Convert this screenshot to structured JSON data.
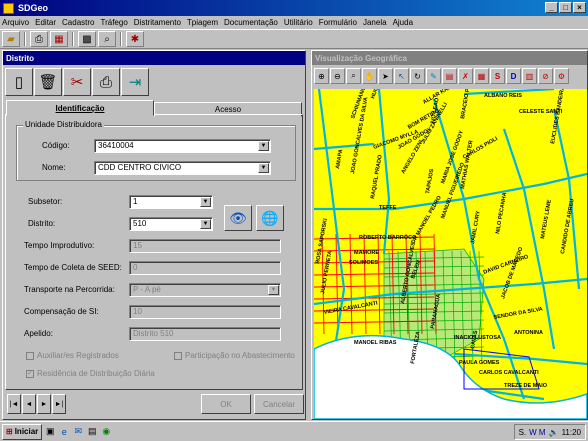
{
  "window": {
    "title": "SDGeo",
    "controls": [
      "_",
      "□",
      "×"
    ]
  },
  "menu": [
    "Arquivo",
    "Editar",
    "Cadastro",
    "Tráfego",
    "Distritamento",
    "Tpiagem",
    "Documentação",
    "Utilitário",
    "Formulário",
    "Janela",
    "Ajuda"
  ],
  "toolbar": {
    "icons": [
      "folder-icon",
      "printer-icon",
      "layout-icon",
      "grid-icon",
      "zoom-icon",
      "cross-icon"
    ]
  },
  "distrito": {
    "panel_title": "Distrito",
    "tabs": [
      "Identificação",
      "Acesso"
    ],
    "group_label": "Unidade Distribuidora",
    "codigo_label": "Código:",
    "codigo_value": "36410004",
    "nome_label": "Nome:",
    "nome_value": "CDD CENTRO CIVICO",
    "subsetor_label": "Subsetor:",
    "subsetor_value": "1",
    "distrito_label": "Distrito:",
    "distrito_value": "510",
    "tempo_improdutivo_label": "Tempo Improdutivo:",
    "tempo_improdutivo_value": "15",
    "tempo_coleta_label": "Tempo de Coleta de SEED:",
    "tempo_coleta_value": "0",
    "transporte_label": "Transporte na Percorrida:",
    "transporte_value": "P - A pé",
    "compensacao_label": "Compensação de SI:",
    "compensacao_value": "10",
    "apelido_label": "Apelido:",
    "apelido_value": "Distrito 510",
    "chk_auxiliar": "Auxiliar/es Registrados",
    "chk_participacao": "Participação no Abastecimento",
    "chk_residencia": "Residência de Distribuição Diária",
    "ok_label": "OK",
    "cancel_label": "Cancelar",
    "nav": [
      "|◄",
      "◄",
      "►",
      "►|"
    ]
  },
  "map": {
    "title": "Visualização Geográfica",
    "streets": [
      "ALBANO REIS",
      "CELESTE SANTI",
      "SCHIUMANO",
      "HUGO SIMAS",
      "ALLAR KARDEC",
      "BOM RETIRO",
      "IVO LEAO",
      "BRACEIO PUTO",
      "GIACOMO MYLLA",
      "JULIO ZANINELLI",
      "JOAO GONCALVES DA SILVA",
      "JOAO GODOY",
      "ANGELO ZENI",
      "CARLOS PIOLI",
      "AMAPA",
      "RAQUEL PRADO",
      "TEFFE",
      "MARIA JOSE GODOY",
      "TAPAJOS",
      "MATHIAS WALTER",
      "MANUEL FIGUEIREDO",
      "EUCLIDES BANDEIRA",
      "ROBERTO BARROCO",
      "ROSA SAPORSKI",
      "DR MANOEL PEDRO",
      "MAMORE",
      "JULIO PERNETA",
      "ALBERTO GONCALVES",
      "SOLIMOES",
      "BELEM",
      "NILO PECANHA",
      "JAMIL CURY",
      "DAVID CARNEIRO",
      "MATEUS LEME",
      "JACOB DE MACEDO",
      "VIEIRA CAVALCANTI",
      "SENDOR DA SILVA",
      "ANTONINA",
      "CANDIDO DE ABREU",
      "MANOEL RIBAS",
      "PARANAGUA",
      "INACIO LUSTOSA",
      "CAVAS",
      "FORTALEZA",
      "PAULA GOMES",
      "CARLOS CAVALCANTI",
      "TREZE DE MAIO"
    ]
  },
  "taskbar": {
    "start": "Iniciar",
    "tray_items": [
      "S.",
      "W M"
    ],
    "clock": "11:20"
  },
  "colors": {
    "titlebar": "#000080",
    "map_bg": "#ffff00",
    "streets": "#00b4e0",
    "grid": "#ff0000",
    "zone": "#00a000",
    "water": "#ffffff"
  }
}
